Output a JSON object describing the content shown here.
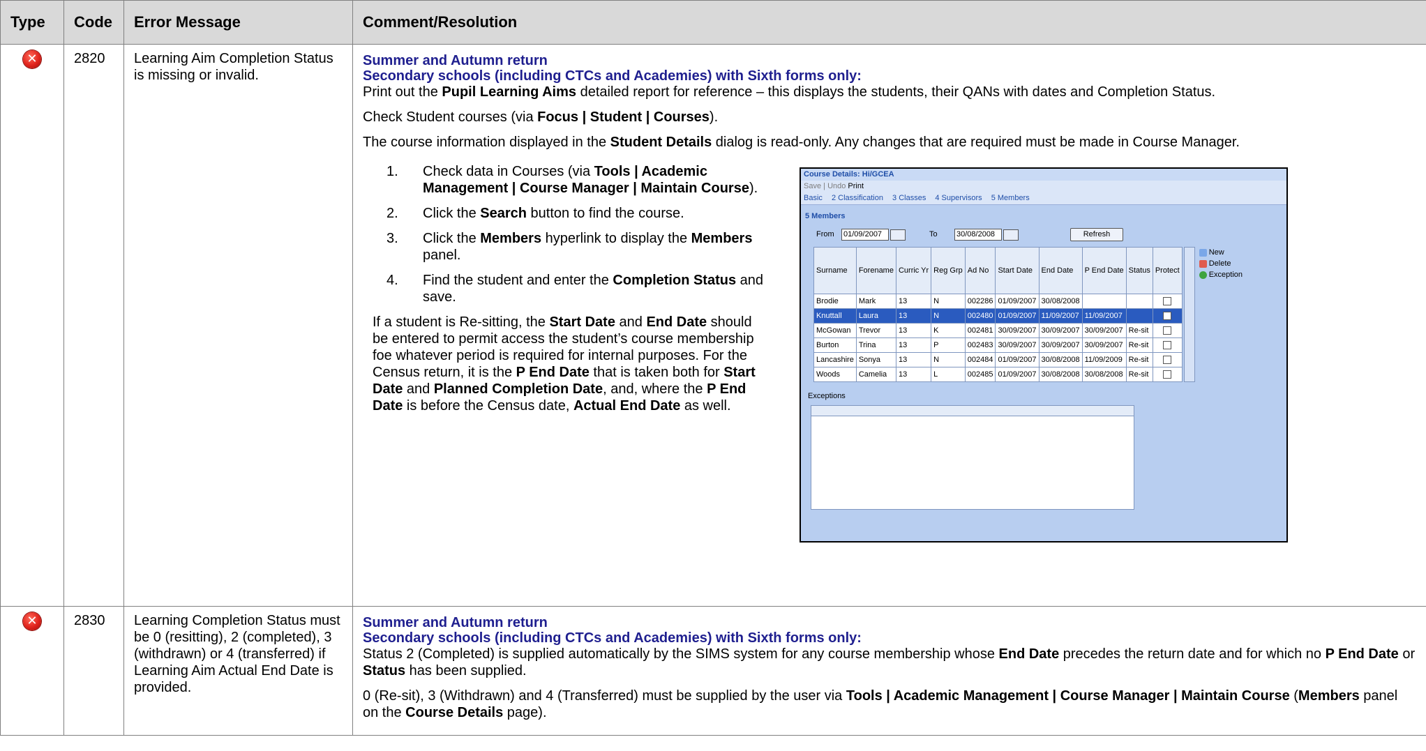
{
  "table": {
    "headers": [
      "Type",
      "Code",
      "Error Message",
      "Comment/Resolution"
    ]
  },
  "rows": [
    {
      "type_icon": "error-icon",
      "code": "2820",
      "message": "Learning Aim Completion Status is missing or invalid.",
      "heading1": "Summer and Autumn return",
      "heading2": "Secondary schools (including CTCs and Academies) with Sixth forms only:",
      "p1_a": "Print out the ",
      "p1_b": "Pupil Learning Aims",
      "p1_c": " detailed report for reference – this displays the students, their QANs with dates and Completion Status.",
      "p2_a": "Check Student courses (via ",
      "p2_b": "Focus | Student | Courses",
      "p2_c": ").",
      "p3_a": "The course information displayed in the ",
      "p3_b": "Student Details",
      "p3_c": " dialog is read-only. Any changes that are required must be made in Course Manager.",
      "steps": [
        {
          "num": "1.",
          "a": "Check data in Courses (via ",
          "b": "Tools | Academic Management | Course Manager | Maintain Course",
          "c": ")."
        },
        {
          "num": "2.",
          "a": "Click the ",
          "b": "Search",
          "c": " button to find the course."
        },
        {
          "num": "3.",
          "a": "Click the ",
          "b": "Members",
          "c": " hyperlink to display the ",
          "d": "Members",
          "e": " panel."
        },
        {
          "num": "4.",
          "a": "Find the student and enter the ",
          "b": "Completion Status",
          "c": " and save."
        }
      ],
      "note": {
        "t1": "If a student is Re-sitting, the ",
        "b1": "Start Date",
        "t2": " and ",
        "b2": "End Date",
        "t3": " should be entered to permit access the student’s course membership foe whatever period is required for internal purposes. For the Census return, it is the ",
        "b3": "P End Date",
        "t4": " that is taken both for ",
        "b4": "Start Date",
        "t5": " and ",
        "b5": "Planned Completion Date",
        "t6": ", and, where the ",
        "b6": "P End Date",
        "t7": " is before the Census date, ",
        "b7": "Actual End Date",
        "t8": " as well."
      }
    },
    {
      "type_icon": "error-icon",
      "code": "2830",
      "message": "Learning Completion Status must be 0 (resitting), 2 (completed), 3 (withdrawn) or 4 (transferred) if Learning Aim Actual End Date is provided.",
      "heading1": "Summer and Autumn return",
      "heading2": "Secondary schools (including CTCs and Academies) with Sixth forms only:",
      "p1_a": "Status 2 (Completed) is supplied automatically by the SIMS system for any course membership whose ",
      "p1_b": "End Date",
      "p1_c": " precedes the return date and for which no ",
      "p1_d": "P End Date",
      "p1_e": " or ",
      "p1_f": "Status",
      "p1_g": " has been supplied.",
      "p2_a": "0 (Re-sit), 3 (Withdrawn) and 4 (Transferred) must be supplied by the user via ",
      "p2_b": "Tools | Academic Management | Course Manager | Maintain Course",
      "p2_c": " (",
      "p2_d": "Members",
      "p2_e": " panel on the ",
      "p2_f": "Course Details",
      "p2_g": " page)."
    }
  ],
  "screenshot": {
    "title": "Course Details: Hi/GCEA",
    "toolbar": {
      "save": "Save",
      "undo": "Undo",
      "print": "Print"
    },
    "links": [
      "Basic",
      "2 Classification",
      "3 Classes",
      "4 Supervisors",
      "5 Members"
    ],
    "members_heading": "5 Members",
    "from_label": "From",
    "from_value": "01/09/2007",
    "to_label": "To",
    "to_value": "30/08/2008",
    "refresh": "Refresh",
    "columns": [
      "Surname",
      "Forename",
      "Curric Yr",
      "Reg Grp",
      "Ad No",
      "Start Date",
      "End Date",
      "P End Date",
      "Status",
      "Protect"
    ],
    "grid_rows": [
      {
        "surname": "Brodie",
        "forename": "Mark",
        "yr": "13",
        "reg": "N",
        "adno": "002286",
        "start": "01/09/2007",
        "end": "30/08/2008",
        "pend": "",
        "status": "",
        "selected": false
      },
      {
        "surname": "Knuttall",
        "forename": "Laura",
        "yr": "13",
        "reg": "N",
        "adno": "002480",
        "start": "01/09/2007",
        "end": "11/09/2007",
        "pend": "11/09/2007",
        "status": "",
        "selected": true
      },
      {
        "surname": "McGowan",
        "forename": "Trevor",
        "yr": "13",
        "reg": "K",
        "adno": "002481",
        "start": "30/09/2007",
        "end": "30/09/2007",
        "pend": "30/09/2007",
        "status": "Re-sit",
        "selected": false
      },
      {
        "surname": "Burton",
        "forename": "Trina",
        "yr": "13",
        "reg": "P",
        "adno": "002483",
        "start": "30/09/2007",
        "end": "30/09/2007",
        "pend": "30/09/2007",
        "status": "Re-sit",
        "selected": false
      },
      {
        "surname": "Lancashire",
        "forename": "Sonya",
        "yr": "13",
        "reg": "N",
        "adno": "002484",
        "start": "01/09/2007",
        "end": "30/08/2008",
        "pend": "11/09/2009",
        "status": "Re-sit",
        "selected": false
      },
      {
        "surname": "Woods",
        "forename": "Camelia",
        "yr": "13",
        "reg": "L",
        "adno": "002485",
        "start": "01/09/2007",
        "end": "30/08/2008",
        "pend": "30/08/2008",
        "status": "Re-sit",
        "selected": false
      }
    ],
    "side_buttons": [
      "New",
      "Delete",
      "Exception"
    ],
    "exceptions_label": "Exceptions"
  }
}
